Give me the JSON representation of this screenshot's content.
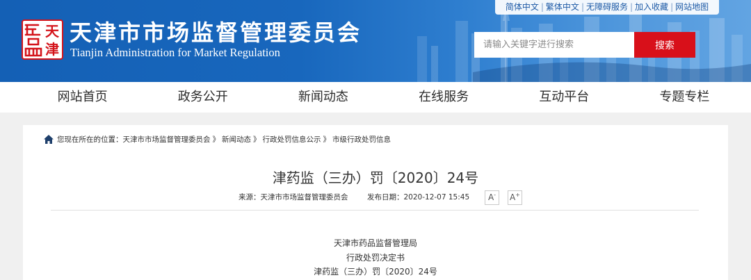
{
  "header": {
    "top_links": [
      "简体中文",
      "繁体中文",
      "无障碍服务",
      "加入收藏",
      "网站地图"
    ],
    "top_links_separator": "|",
    "logo": {
      "lettering": [
        "天",
        "津"
      ]
    },
    "site_title": "天津市市场监督管理委员会",
    "site_subtitle": "Tianjin Administration for Market Regulation",
    "search": {
      "placeholder": "请输入关键字进行搜索",
      "value": "",
      "button_label": "搜索"
    }
  },
  "nav": {
    "items": [
      "网站首页",
      "政务公开",
      "新闻动态",
      "在线服务",
      "互动平台",
      "专题专栏"
    ]
  },
  "breadcrumb": {
    "icon": "home-icon",
    "prefix": "您现在所在的位置：",
    "separator": "》",
    "items": [
      "天津市市场监督管理委员会",
      "新闻动态",
      "行政处罚信息公示",
      "市级行政处罚信息"
    ]
  },
  "article": {
    "title": "津药监（三办）罚〔2020〕24号",
    "source_label": "来源：",
    "source": "天津市市场监督管理委员会",
    "date_label": "发布日期：",
    "date": "2020-12-07 15:45",
    "font_size_buttons": [
      {
        "letter": "A",
        "sign": "-"
      },
      {
        "letter": "A",
        "sign": "+"
      }
    ],
    "body_lines": [
      "天津市药品监督管理局",
      "行政处罚决定书",
      "津药监（三办）罚〔2020〕24号"
    ]
  },
  "colors": {
    "header_blue": "#1460b5",
    "search_button_red": "#d8101a",
    "logo_red": "#d4141b",
    "page_background": "#f0f0f0",
    "top_link_text": "#1d5aa6"
  }
}
